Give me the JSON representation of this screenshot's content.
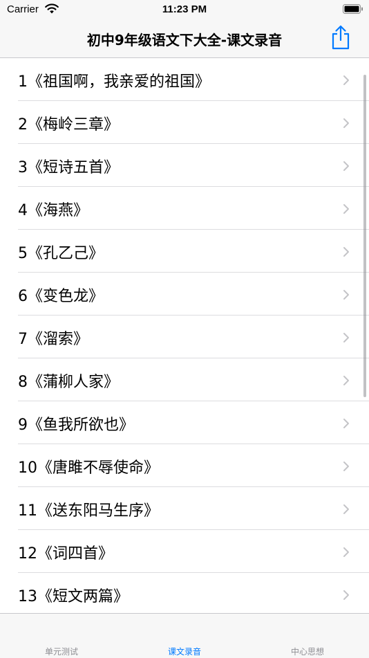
{
  "status_bar": {
    "carrier": "Carrier",
    "time": "11:23 PM"
  },
  "nav": {
    "title": "初中9年级语文下大全-课文录音",
    "share_icon": "share-icon",
    "accent_color": "#007aff"
  },
  "lessons": [
    "1《祖国啊，我亲爱的祖国》",
    "2《梅岭三章》",
    "3《短诗五首》",
    "4《海燕》",
    "5《孔乙己》",
    "6《变色龙》",
    "7《溜索》",
    "8《蒲柳人家》",
    "9《鱼我所欲也》",
    "10《唐雎不辱使命》",
    "11《送东阳马生序》",
    "12《词四首》",
    "13《短文两篇》"
  ],
  "tabs": [
    {
      "label": "单元测试",
      "active": false
    },
    {
      "label": "课文录音",
      "active": true
    },
    {
      "label": "中心思想",
      "active": false
    }
  ],
  "colors": {
    "active_tab": "#007aff",
    "inactive_tab": "#8e8e93",
    "chevron": "#c4c4c7"
  }
}
